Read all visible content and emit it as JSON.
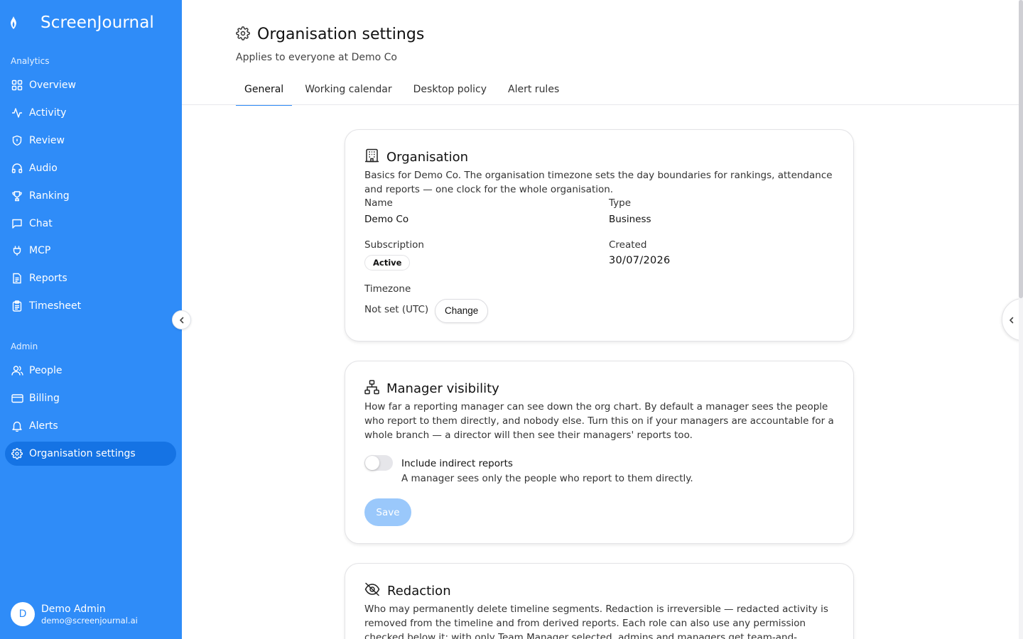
{
  "app": {
    "name": "ScreenJournal"
  },
  "sidebar": {
    "analytics_label": "Analytics",
    "admin_label": "Admin",
    "analytics_items": [
      {
        "label": "Overview",
        "icon": "grid-icon"
      },
      {
        "label": "Activity",
        "icon": "activity-icon"
      },
      {
        "label": "Review",
        "icon": "shield-icon"
      },
      {
        "label": "Audio",
        "icon": "headphones-icon"
      },
      {
        "label": "Ranking",
        "icon": "trophy-icon"
      },
      {
        "label": "Chat",
        "icon": "chat-icon"
      },
      {
        "label": "MCP",
        "icon": "plug-icon"
      },
      {
        "label": "Reports",
        "icon": "document-icon"
      },
      {
        "label": "Timesheet",
        "icon": "clipboard-icon"
      }
    ],
    "admin_items": [
      {
        "label": "People",
        "icon": "users-icon"
      },
      {
        "label": "Billing",
        "icon": "credit-card-icon"
      },
      {
        "label": "Alerts",
        "icon": "bell-icon"
      },
      {
        "label": "Organisation settings",
        "icon": "gear-icon",
        "active": true
      }
    ],
    "user": {
      "initial": "D",
      "name": "Demo Admin",
      "email": "demo@screenjournal.ai"
    }
  },
  "page": {
    "title": "Organisation settings",
    "subtitle": "Applies to everyone at Demo Co",
    "tabs": [
      {
        "label": "General",
        "active": true
      },
      {
        "label": "Working calendar"
      },
      {
        "label": "Desktop policy"
      },
      {
        "label": "Alert rules"
      }
    ]
  },
  "organisation": {
    "title": "Organisation",
    "description": "Basics for Demo Co. The organisation timezone sets the day boundaries for rankings, attendance and reports — one clock for the whole organisation.",
    "name_label": "Name",
    "name_value": "Demo Co",
    "type_label": "Type",
    "type_value": "Business",
    "subscription_label": "Subscription",
    "subscription_value": "Active",
    "created_label": "Created",
    "created_value": "30/07/2026",
    "timezone_label": "Timezone",
    "timezone_value": "Not set (UTC)",
    "change_label": "Change"
  },
  "manager_visibility": {
    "title": "Manager visibility",
    "description": "How far a reporting manager can see down the org chart. By default a manager sees the people who report to them directly, and nobody else. Turn this on if your managers are accountable for a whole branch — a director will then see their managers' reports too.",
    "toggle_label": "Include indirect reports",
    "toggle_on": false,
    "toggle_help": "A manager sees only the people who report to them directly.",
    "save_label": "Save"
  },
  "redaction": {
    "title": "Redaction",
    "description": "Who may permanently delete timeline segments. Redaction is irreversible — redacted activity is removed from the timeline and from derived reports. Each role can also use any permission checked below it: with only Team Manager selected, admins and managers get team-and-reportee"
  },
  "colors": {
    "sidebar": "#2f8cf8",
    "active_nav": "#1573e4",
    "accent": "#2f8cf8",
    "save_disabled": "#9ac8fb"
  }
}
